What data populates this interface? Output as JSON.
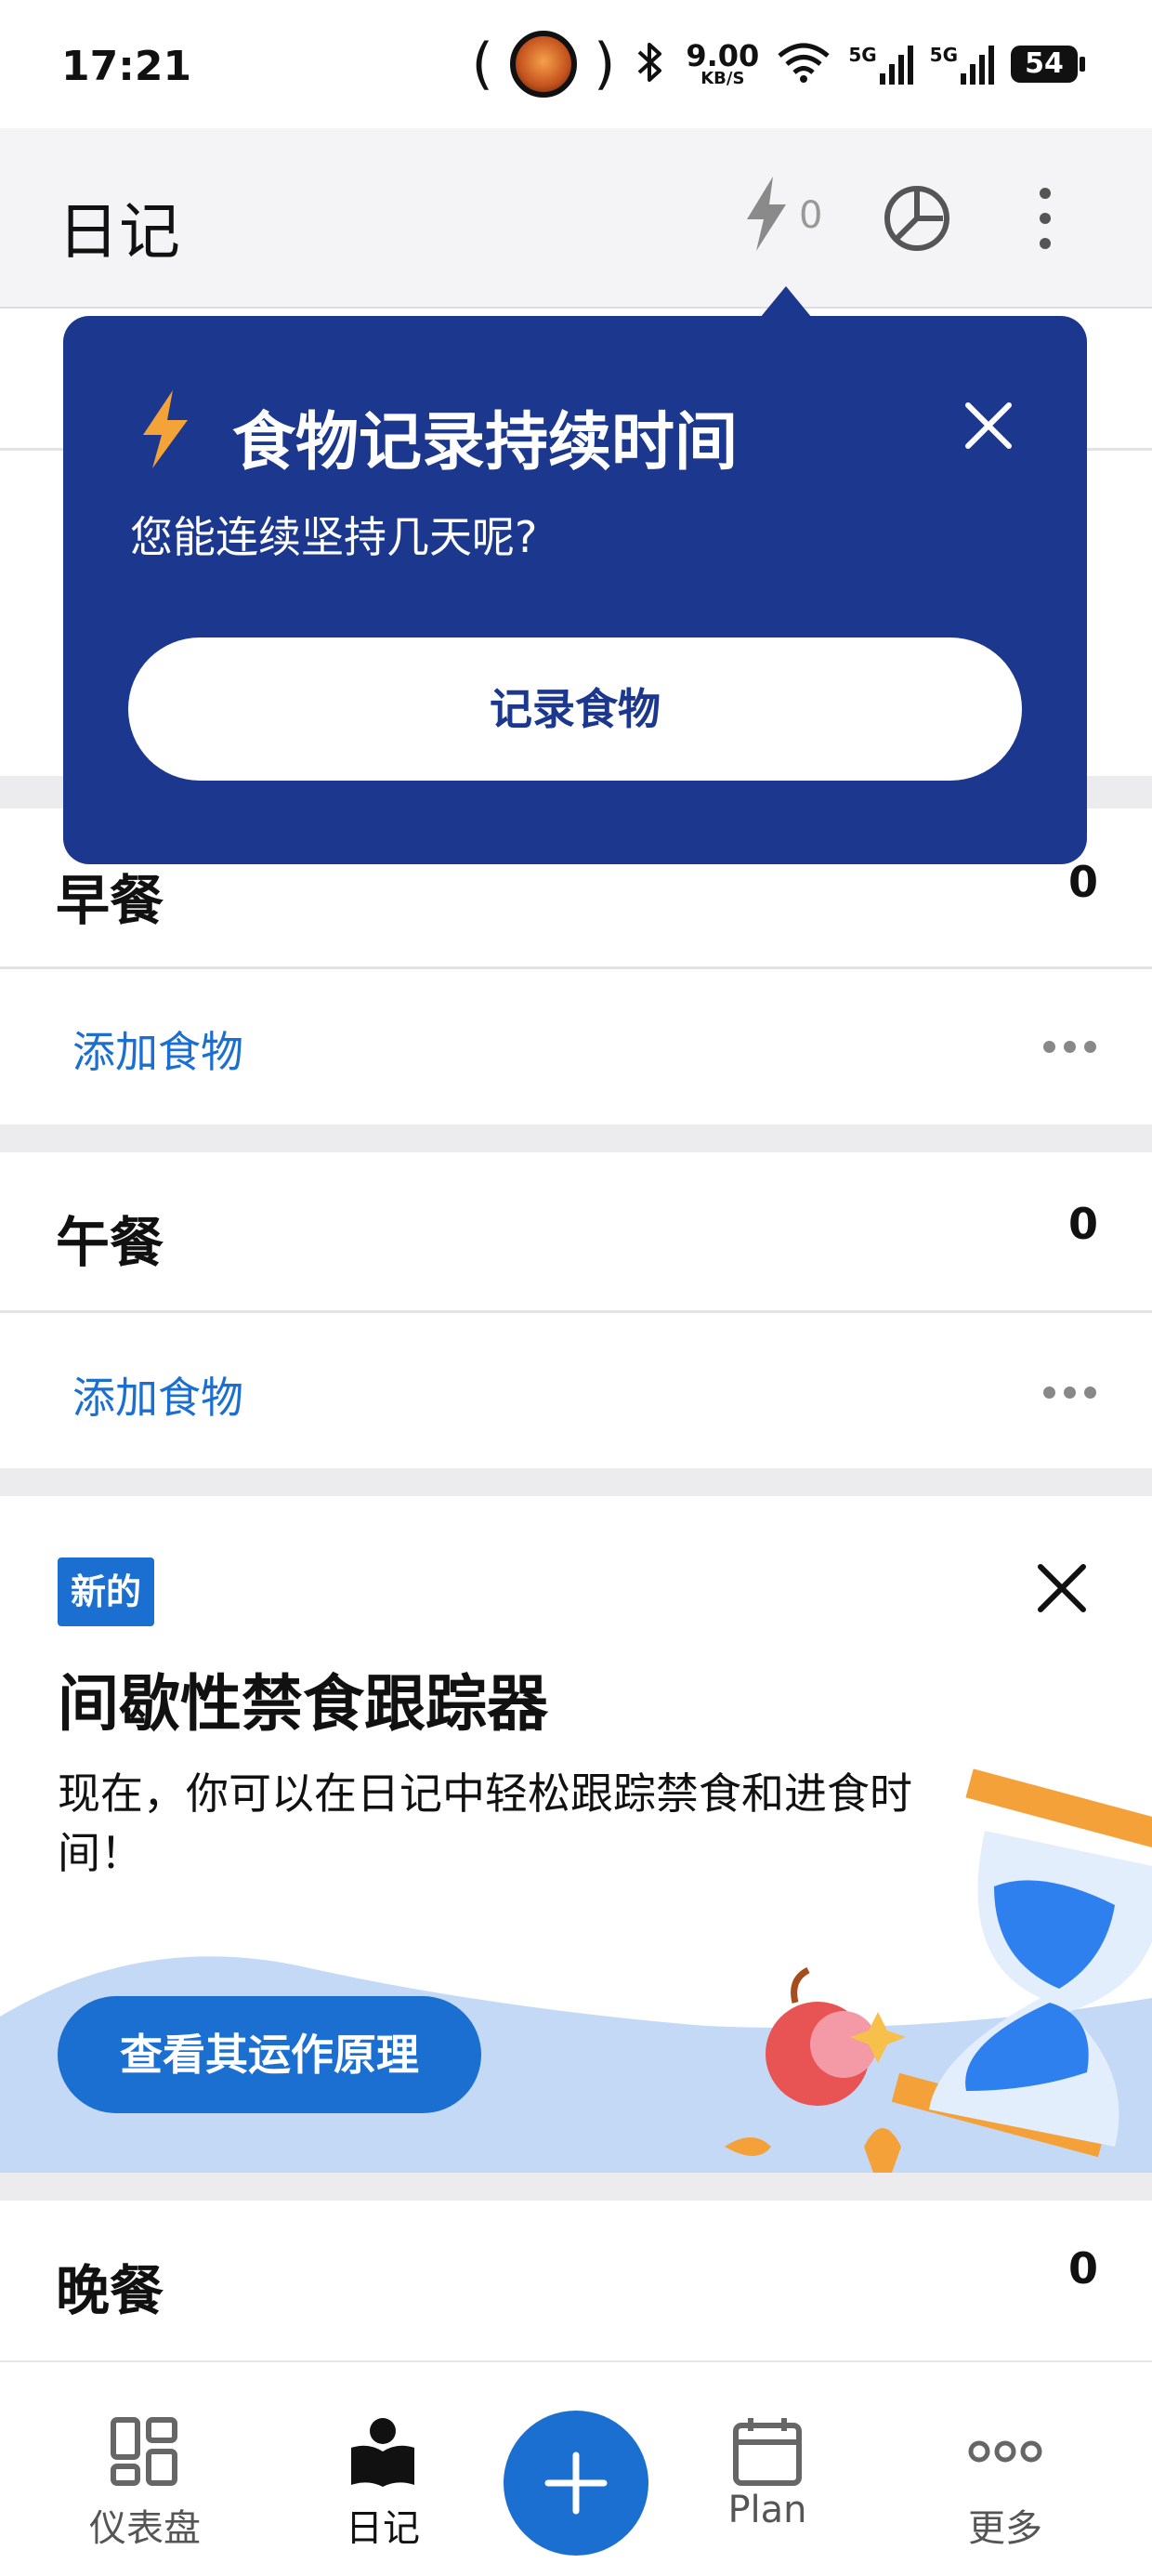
{
  "status_bar": {
    "time": "17:21",
    "speed_value": "9.00",
    "speed_unit": "KB/S",
    "net_label_1": "5G",
    "net_label_2": "5G",
    "battery": "54",
    "icons": [
      "avatar-icon",
      "bluetooth-icon",
      "wifi-icon",
      "signal-icon",
      "battery-icon"
    ]
  },
  "app_bar": {
    "title": "日记",
    "streak_count": "0",
    "icons": [
      "lightning-icon",
      "pie-chart-icon",
      "more-vert-icon"
    ]
  },
  "popover": {
    "title": "食物记录持续时间",
    "subtitle": "您能连续坚持几天呢?",
    "button": "记录食物",
    "accent_color": "#1c388e",
    "bolt_color": "#f4a338"
  },
  "meals": [
    {
      "name": "早餐",
      "calories": "0",
      "add_label": "添加食物"
    },
    {
      "name": "午餐",
      "calories": "0",
      "add_label": "添加食物"
    },
    {
      "name": "晚餐",
      "calories": "0"
    }
  ],
  "fasting_card": {
    "badge": "新的",
    "title": "间歇性禁食跟踪器",
    "description": "现在，你可以在日记中轻松跟踪禁食和进食时间！",
    "button": "查看其运作原理"
  },
  "bottom_nav": {
    "items": [
      {
        "label": "仪表盘",
        "icon": "dashboard-icon"
      },
      {
        "label": "日记",
        "icon": "diary-icon",
        "active": true
      },
      {
        "label": "Plan",
        "icon": "calendar-icon"
      },
      {
        "label": "更多",
        "icon": "more-horiz-icon"
      }
    ],
    "fab_icon": "plus-icon"
  },
  "colors": {
    "primary": "#1a6fd1",
    "popover": "#1c388e",
    "background": "#ececee"
  }
}
